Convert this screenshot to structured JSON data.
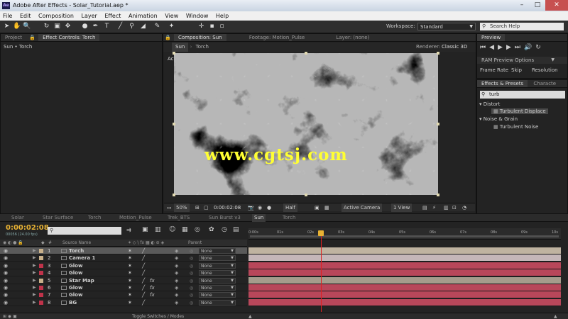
{
  "window": {
    "title": "Adobe After Effects - Solar_Tutorial.aep *",
    "app_icon": "Ae"
  },
  "menu": [
    "File",
    "Edit",
    "Composition",
    "Layer",
    "Effect",
    "Animation",
    "View",
    "Window",
    "Help"
  ],
  "toolbar": {
    "workspace_label": "Workspace:",
    "workspace_value": "Standard",
    "search_placeholder": "Search Help"
  },
  "project_panel": {
    "tabs": [
      "Project",
      "Effect Controls: Torch"
    ],
    "breadcrumb": "Sun • Torch"
  },
  "comp_panel": {
    "tabs": [
      "Composition: Sun",
      "Footage: Motion_Pulse",
      "Layer: (none)"
    ],
    "subtabs": [
      "Sun",
      "Torch"
    ],
    "renderer_label": "Renderer:",
    "renderer_value": "Classic 3D",
    "camera_label": "Active Camera",
    "watermark": "www.cgtsj.com",
    "bar": {
      "zoom": "50%",
      "timecode": "0:00:02:08",
      "resolution": "Half",
      "view": "Active Camera",
      "views": "1 View"
    }
  },
  "preview_panel": {
    "title": "Preview",
    "ram_options": "RAM Preview Options",
    "cols": [
      "Frame Rate",
      "Skip",
      "Resolution"
    ]
  },
  "effects_panel": {
    "tabs": [
      "Effects & Presets",
      "Characte"
    ],
    "search_value": "turb",
    "groups": [
      {
        "name": "Distort",
        "items": [
          "Turbulent Displace"
        ]
      },
      {
        "name": "Noise & Grain",
        "items": [
          "Turbulent Noise"
        ]
      }
    ]
  },
  "timeline": {
    "tabs": [
      "Solar",
      "Star Surface",
      "Torch",
      "Motion_Pulse",
      "Trek_BTS",
      "Sun Burst v3",
      "Sun",
      "Torch"
    ],
    "active_tab": "Sun",
    "timecode": "0:00:02:08",
    "fps": "00056 (24.00 fps)",
    "col_headers": {
      "num": "#",
      "source": "Source Name",
      "parent": "Parent"
    },
    "ruler": [
      "0:00s",
      "01s",
      "02s",
      "03s",
      "04s",
      "05s",
      "06s",
      "07s",
      "08s",
      "09s",
      "10s"
    ],
    "layers": [
      {
        "num": "1",
        "name": "Torch",
        "color": "#c8b08a",
        "fx": false,
        "parent": "None",
        "track": "#bfb3a0",
        "sel": true
      },
      {
        "num": "2",
        "name": "Camera 1",
        "color": "#c8b08a",
        "fx": false,
        "parent": "None",
        "track": "#c4b6b8",
        "sel": false
      },
      {
        "num": "3",
        "name": "Glow",
        "color": "#c0334a",
        "fx": false,
        "parent": "None",
        "track": "#b8475a",
        "sel": false
      },
      {
        "num": "4",
        "name": "Glow",
        "color": "#c0334a",
        "fx": false,
        "parent": "None",
        "track": "#b8475a",
        "sel": false
      },
      {
        "num": "5",
        "name": "Star Map",
        "color": "#c8b08a",
        "fx": true,
        "parent": "None",
        "track": "#a59c8c",
        "sel": false
      },
      {
        "num": "6",
        "name": "Glow",
        "color": "#c0334a",
        "fx": true,
        "parent": "None",
        "track": "#b8475a",
        "sel": false
      },
      {
        "num": "7",
        "name": "Glow",
        "color": "#c0334a",
        "fx": true,
        "parent": "None",
        "track": "#b8475a",
        "sel": false
      },
      {
        "num": "8",
        "name": "BG",
        "color": "#c0334a",
        "fx": false,
        "parent": "None",
        "track": "#b8475a",
        "sel": false
      }
    ],
    "toggle_label": "Toggle Switches / Modes"
  }
}
